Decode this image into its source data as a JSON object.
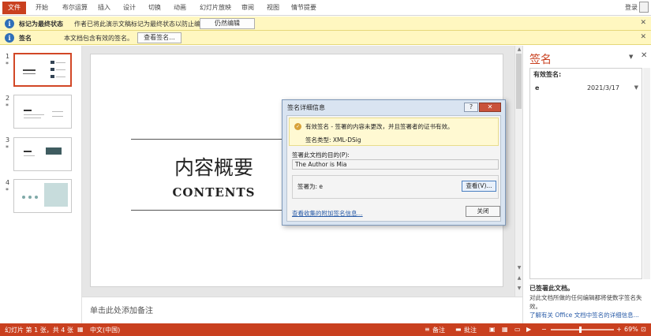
{
  "ribbon": {
    "tabs": [
      "文件",
      "开始",
      "布尔运算",
      "插入",
      "设计",
      "切换",
      "动画",
      "幻灯片放映",
      "审阅",
      "视图",
      "情节提要"
    ],
    "login": "登录"
  },
  "msgbars": [
    {
      "title": "标记为最终状态",
      "text": "作者已将此演示文稿标记为最终状态以防止编辑。",
      "button": "仍然编辑",
      "close": "✕"
    },
    {
      "title": "签名",
      "text": "本文档包含有效的签名。",
      "button": "查看签名...",
      "close": "✕"
    }
  ],
  "thumbnails": [
    {
      "num": "1",
      "star": "*"
    },
    {
      "num": "2",
      "star": "*"
    },
    {
      "num": "3",
      "star": "*"
    },
    {
      "num": "4",
      "star": "*"
    }
  ],
  "slide": {
    "title": "内容概要",
    "subtitle": "CONTENTS"
  },
  "notes": {
    "placeholder": "单击此处添加备注"
  },
  "signature_pane": {
    "title": "签名",
    "menu": "▼",
    "close": "✕",
    "list_header": "有效签名:",
    "signer": "e",
    "date": "2021/3/17",
    "arrow": "▼",
    "footer_title": "已签署此文档。",
    "footer_text": "对此文档所做的任何编辑都将使数字签名失效。",
    "footer_link": "了解有关 Office 文档中签名的详细信息..."
  },
  "dialog": {
    "title": "签名详细信息",
    "help": "?",
    "close": "✕",
    "valid_text": "有效签名 - 签署的内容未更改，并且签署者的证书有效。",
    "sig_type": "签名类型: XML-DSig",
    "purpose_label": "签署此文档的目的(P):",
    "purpose_value": "The Author is Mia",
    "signer_label": "签署为:   e",
    "view_button": "查看(V)...",
    "link": "查看收集的附加签名信息...",
    "close_button": "关闭"
  },
  "statusbar": {
    "slide_info": "幻灯片 第 1 张，共 4 张",
    "language": "中文(中国)",
    "notes": "备注",
    "comments": "批注",
    "zoom": "69%"
  },
  "colors": {
    "accent": "#c9401f",
    "msgbar": "#fff7c0"
  }
}
